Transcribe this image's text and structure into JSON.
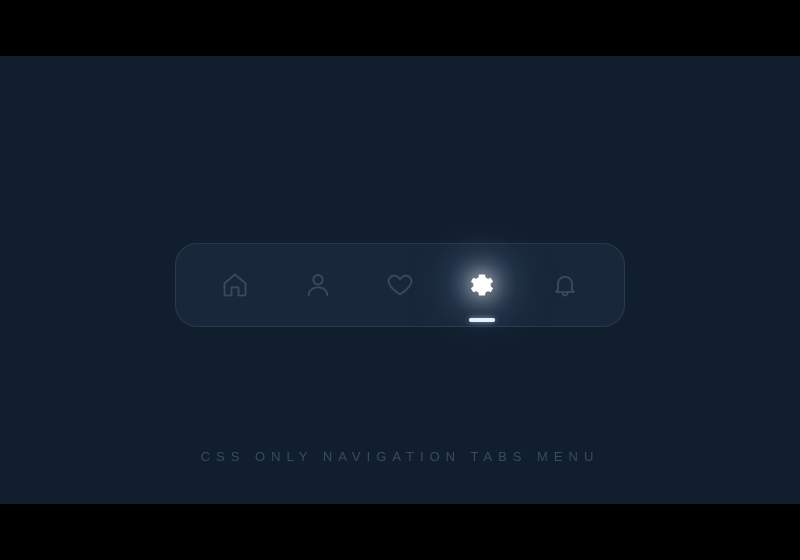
{
  "caption": "CSS ONLY NAVIGATION TABS MENU",
  "tabs": [
    {
      "name": "home",
      "active": false
    },
    {
      "name": "profile",
      "active": false
    },
    {
      "name": "favorite",
      "active": false
    },
    {
      "name": "settings",
      "active": true
    },
    {
      "name": "alerts",
      "active": false
    }
  ]
}
